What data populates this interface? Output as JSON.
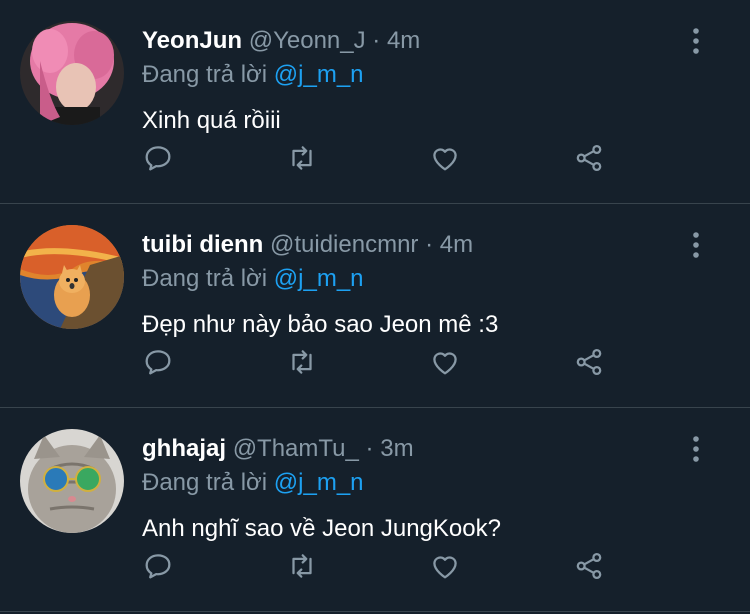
{
  "tweets": [
    {
      "name": "YeonJun",
      "handle": "@Yeonn_J",
      "dot": "·",
      "time": "4m",
      "reply_prefix": "Đang trả lời ",
      "mention": "@j_m_n",
      "text": "Xinh quá rồiii",
      "avatar": "pink-haired-person-avatar"
    },
    {
      "name": "tuibi dienn",
      "handle": "@tuidiencmnr",
      "dot": "·",
      "time": "4m",
      "reply_prefix": "Đang trả lời ",
      "mention": "@j_m_n",
      "text": "Đẹp như này bảo sao Jeon mê :3",
      "avatar": "scream-painting-cat-avatar"
    },
    {
      "name": "ghhajaj",
      "handle": "@ThamTu_",
      "dot": "·",
      "time": "3m",
      "reply_prefix": "Đang trả lời ",
      "mention": "@j_m_n",
      "text": "Anh nghĩ sao về Jeon JungKook?",
      "avatar": "cat-with-sunglasses-avatar"
    }
  ],
  "colors": {
    "background": "#15202b",
    "muted": "#8899a6",
    "mention": "#1da1f2",
    "divider": "#38444d"
  },
  "icons": [
    "more-vertical-icon",
    "reply-icon",
    "retweet-icon",
    "like-icon",
    "share-icon"
  ]
}
